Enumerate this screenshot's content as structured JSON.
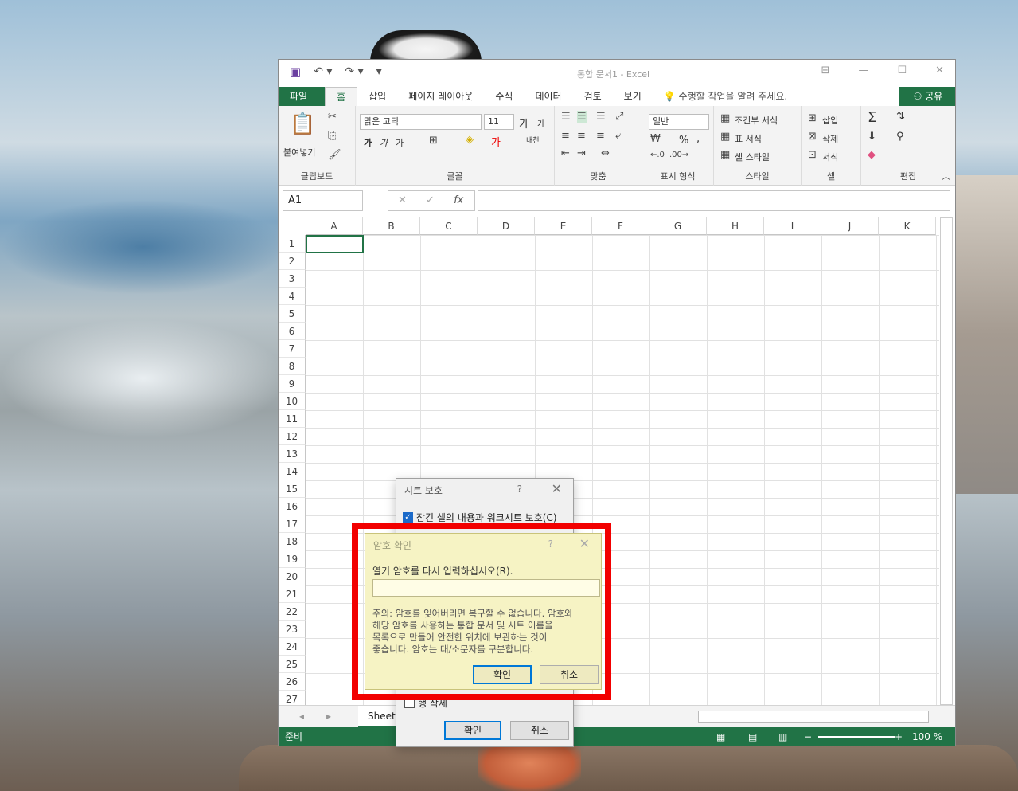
{
  "excel": {
    "title": "통합 문서1 - Excel",
    "tabs": [
      "파일",
      "홈",
      "삽입",
      "페이지 레이아웃",
      "수식",
      "데이터",
      "검토",
      "보기"
    ],
    "tell_me": "수행할 작업을 알려 주세요.",
    "share": "공유",
    "ribbon": {
      "clipboard": {
        "paste": "붙여넣기",
        "label": "클립보드"
      },
      "font": {
        "name": "맑은 고딕",
        "size": "11",
        "label": "글꼴",
        "bold": "가",
        "italic": "가",
        "underline": "가",
        "grow": "가",
        "shrink": "가",
        "phonetic": "내천"
      },
      "alignment": {
        "label": "맞춤"
      },
      "number": {
        "format": "일반",
        "percent": "%",
        "comma": ",",
        "label": "표시 형식"
      },
      "styles": {
        "cond": "조건부 서식",
        "table": "표 서식",
        "cell": "셀 스타일",
        "label": "스타일"
      },
      "cells": {
        "insert": "삽입",
        "delete": "삭제",
        "format": "서식",
        "label": "셀"
      },
      "editing": {
        "label": "편집",
        "sum": "Σ",
        "sort": "⇅",
        "find": "⚲"
      }
    },
    "namebox": "A1",
    "fx": "fx",
    "columns": [
      "A",
      "B",
      "C",
      "D",
      "E",
      "F",
      "G",
      "H",
      "I",
      "J",
      "K"
    ],
    "rows": [
      "1",
      "2",
      "3",
      "4",
      "5",
      "6",
      "7",
      "8",
      "9",
      "10",
      "11",
      "12",
      "13",
      "14",
      "15",
      "16",
      "17",
      "18",
      "19",
      "20",
      "21",
      "22",
      "23",
      "24",
      "25",
      "26",
      "27"
    ],
    "sheet_tab": "Sheet",
    "status": "준비",
    "zoom": "100 %"
  },
  "protect_dialog": {
    "title": "시트 보호",
    "help": "?",
    "close": "✕",
    "protect_locked": "잠긴 셀의 내용과 워크시트 보호(C)",
    "row_delete": "행 삭제",
    "ok": "확인",
    "cancel": "취소"
  },
  "confirm_dialog": {
    "title": "암호 확인",
    "help": "?",
    "close": "✕",
    "prompt": "열기 암호를 다시 입력하십시오(R).",
    "password_value": "",
    "warning_lines": [
      "주의: 암호를 잊어버리면 복구할 수 없습니다. 암호와",
      "해당 암호를 사용하는 통합 문서 및 시트 이름을",
      "목록으로 만들어 안전한 위치에 보관하는 것이",
      "좋습니다. 암호는 대/소문자를 구분합니다."
    ],
    "ok": "확인",
    "cancel": "취소"
  },
  "colors": {
    "excel_green": "#217346",
    "highlight_red": "#f20000",
    "dialog_yellow": "#f6f3c4"
  }
}
